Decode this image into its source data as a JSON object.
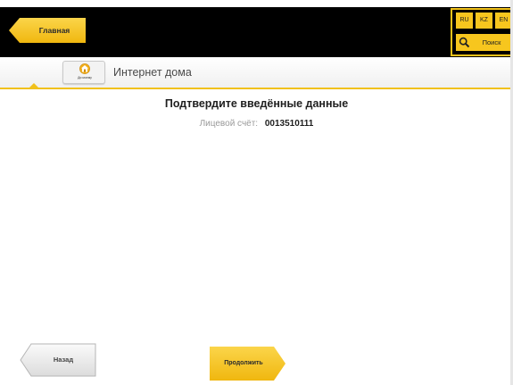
{
  "header": {
    "home_label": "Главная",
    "languages": [
      "RU",
      "KZ",
      "EN"
    ],
    "search_label": "Поиск"
  },
  "service": {
    "name": "Интернет дома",
    "logo_text": "Ди моему"
  },
  "main": {
    "title": "Подтвердите введённые данные",
    "account_label": "Лицевой счёт:",
    "account_value": "0013510111"
  },
  "footer": {
    "back_label": "Назад",
    "continue_label": "Продолжить"
  },
  "colors": {
    "accent": "#f7c61e",
    "topbar": "#000000",
    "background": "#ffffff"
  }
}
